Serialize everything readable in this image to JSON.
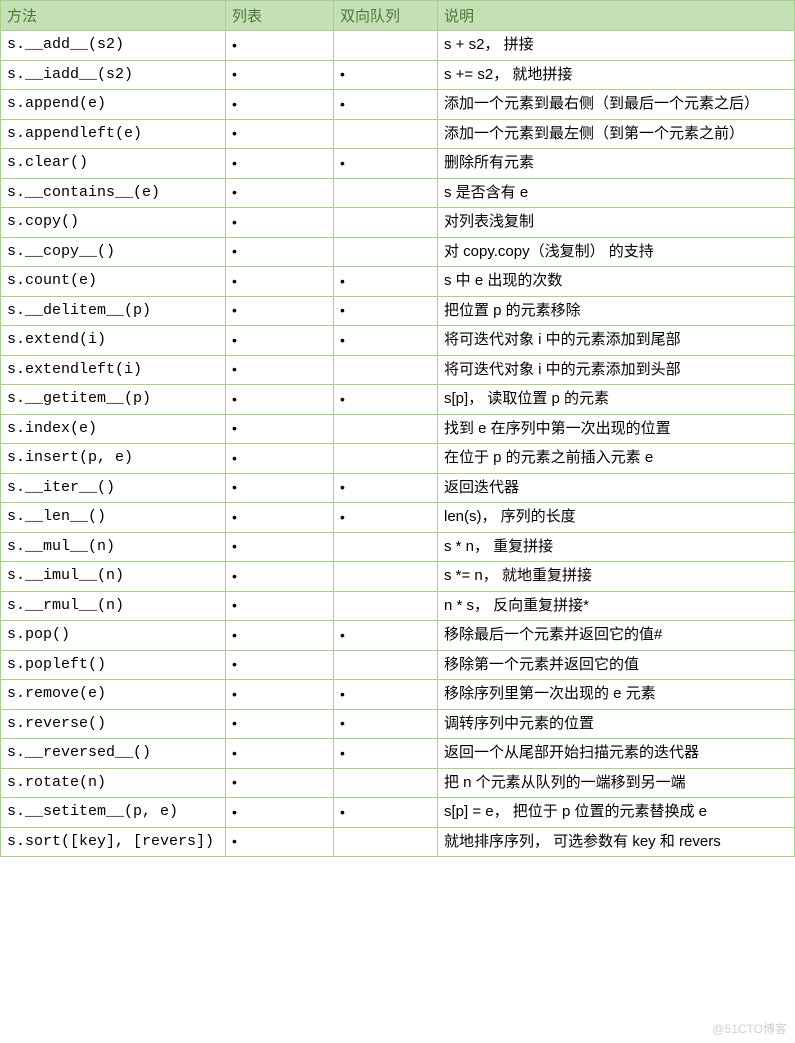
{
  "header": {
    "method": "方法",
    "list": "列表",
    "deque": "双向队列",
    "desc": "说明"
  },
  "bullet": "•",
  "rows": [
    {
      "method": "s.__add__(s2)",
      "list": true,
      "deque": false,
      "desc": "s + s2， 拼接"
    },
    {
      "method": "s.__iadd__(s2)",
      "list": true,
      "deque": true,
      "desc": "s += s2， 就地拼接"
    },
    {
      "method": "s.append(e)",
      "list": true,
      "deque": true,
      "desc": "添加一个元素到最右侧（到最后一个元素之后）"
    },
    {
      "method": "s.appendleft(e)",
      "list": true,
      "deque": false,
      "desc": "添加一个元素到最左侧（到第一个元素之前）"
    },
    {
      "method": "s.clear()",
      "list": true,
      "deque": true,
      "desc": "删除所有元素"
    },
    {
      "method": "s.__contains__(e)",
      "list": true,
      "deque": false,
      "desc": "s 是否含有 e"
    },
    {
      "method": "s.copy()",
      "list": true,
      "deque": false,
      "desc": "对列表浅复制"
    },
    {
      "method": "s.__copy__()",
      "list": true,
      "deque": false,
      "desc": "对 copy.copy（浅复制） 的支持"
    },
    {
      "method": "s.count(e)",
      "list": true,
      "deque": true,
      "desc": "s 中 e 出现的次数"
    },
    {
      "method": "s.__delitem__(p)",
      "list": true,
      "deque": true,
      "desc": "把位置 p 的元素移除"
    },
    {
      "method": "s.extend(i)",
      "list": true,
      "deque": true,
      "desc": "将可迭代对象 i 中的元素添加到尾部"
    },
    {
      "method": "s.extendleft(i)",
      "list": true,
      "deque": false,
      "desc": "将可迭代对象 i 中的元素添加到头部"
    },
    {
      "method": "s.__getitem__(p)",
      "list": true,
      "deque": true,
      "desc": "s[p]， 读取位置 p 的元素"
    },
    {
      "method": "s.index(e)",
      "list": true,
      "deque": false,
      "desc": "找到 e 在序列中第一次出现的位置"
    },
    {
      "method": "s.insert(p, e)",
      "list": true,
      "deque": false,
      "desc": "在位于 p 的元素之前插入元素 e"
    },
    {
      "method": "s.__iter__()",
      "list": true,
      "deque": true,
      "desc": "返回迭代器"
    },
    {
      "method": "s.__len__()",
      "list": true,
      "deque": true,
      "desc": "len(s)， 序列的长度"
    },
    {
      "method": "s.__mul__(n)",
      "list": true,
      "deque": false,
      "desc": "s * n， 重复拼接"
    },
    {
      "method": "s.__imul__(n)",
      "list": true,
      "deque": false,
      "desc": "s *= n， 就地重复拼接"
    },
    {
      "method": "s.__rmul__(n)",
      "list": true,
      "deque": false,
      "desc": "n * s， 反向重复拼接*"
    },
    {
      "method": "s.pop()",
      "list": true,
      "deque": true,
      "desc": "移除最后一个元素并返回它的值#"
    },
    {
      "method": "s.popleft()",
      "list": true,
      "deque": false,
      "desc": "移除第一个元素并返回它的值"
    },
    {
      "method": "s.remove(e)",
      "list": true,
      "deque": true,
      "desc": "移除序列里第一次出现的 e 元素"
    },
    {
      "method": "s.reverse()",
      "list": true,
      "deque": true,
      "desc": "调转序列中元素的位置"
    },
    {
      "method": "s.__reversed__()",
      "list": true,
      "deque": true,
      "desc": "返回一个从尾部开始扫描元素的迭代器"
    },
    {
      "method": "s.rotate(n)",
      "list": true,
      "deque": false,
      "desc": "把 n 个元素从队列的一端移到另一端"
    },
    {
      "method": "s.__setitem__(p, e)",
      "list": true,
      "deque": true,
      "desc": "s[p] = e， 把位于 p 位置的元素替换成 e"
    },
    {
      "method": "s.sort([key], [revers])",
      "list": true,
      "deque": false,
      "desc": "就地排序序列， 可选参数有 key 和 revers"
    }
  ],
  "watermark": "@51CTO博客"
}
